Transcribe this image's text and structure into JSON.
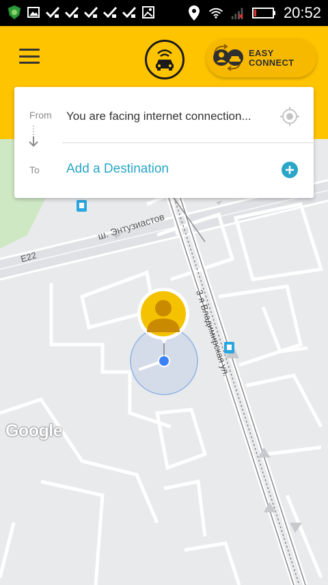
{
  "status_bar": {
    "time": "20:52",
    "icons": [
      "shield-app-icon",
      "gallery-icon",
      "check-icon",
      "check-icon",
      "check-icon",
      "check-icon",
      "check-icon",
      "image-icon",
      "location-icon",
      "wifi-icon",
      "signal-icon",
      "battery-icon"
    ]
  },
  "header": {
    "menu_icon": "hamburger-menu-icon",
    "logo_icon": "taxi-logo-icon",
    "easy_connect": {
      "line1": "EASY",
      "line2": "CONNECT"
    },
    "colors": {
      "brand_yellow": "#ffc400",
      "button_yellow": "#f7b900"
    }
  },
  "trip_card": {
    "from_label": "From",
    "from_value": "You are facing internet connection...",
    "to_label": "To",
    "destination_placeholder": "Add a Destination",
    "colors": {
      "accent": "#2aa6c8"
    }
  },
  "map": {
    "road_labels": {
      "highway": "ш. Энтузиастов",
      "route": "E22",
      "street": "3-я Владимирская ул."
    },
    "user_pin_icon": "user-avatar-pin-icon",
    "location_dot_color": "#3b82f6",
    "attribution": "Google"
  }
}
